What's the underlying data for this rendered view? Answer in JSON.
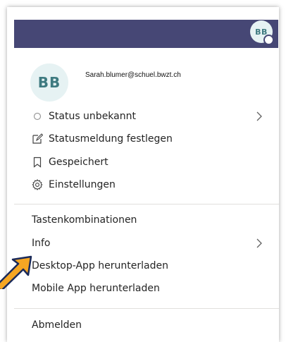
{
  "header": {
    "avatar_initials": "BB"
  },
  "profile": {
    "initials": "BB",
    "email": "Sarah.blumer@schuel.bwzt.ch"
  },
  "status_items": [
    {
      "label": "Status unbekannt",
      "icon": "status-circle-icon"
    },
    {
      "label": "Statusmeldung festlegen",
      "icon": "edit-message-icon"
    },
    {
      "label": "Gespeichert",
      "icon": "bookmark-icon"
    },
    {
      "label": "Einstellungen",
      "icon": "gear-icon"
    }
  ],
  "menu": {
    "shortcuts": "Tastenkombinationen",
    "info": "Info",
    "desktop_app": "Desktop-App herunterladen",
    "mobile_app": "Mobile App herunterladen",
    "logout": "Abmelden"
  },
  "colors": {
    "header_bar": "#464775",
    "avatar_bg": "#e6f2f3",
    "avatar_text": "#3e7a80",
    "arrow": "#f5a623"
  }
}
